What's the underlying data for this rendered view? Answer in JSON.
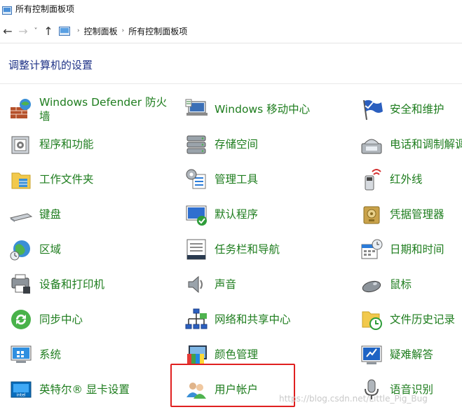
{
  "window": {
    "title": "所有控制面板项"
  },
  "nav": {
    "back_glyph": "←",
    "forward_glyph": "→",
    "recent_glyph": "˅",
    "up_glyph": "↑",
    "breadcrumb": [
      "控制面板",
      "所有控制面板项"
    ],
    "breadcrumb_sep": "›"
  },
  "heading": "调整计算机的设置",
  "colors": {
    "link_green": "#1e7d1e",
    "heading_blue": "#1e3287",
    "highlight_red": "#e02020"
  },
  "items": [
    {
      "label": "Windows Defender 防火墙",
      "icon": "firewall-icon"
    },
    {
      "label": "Windows 移动中心",
      "icon": "mobility-center-icon"
    },
    {
      "label": "安全和维护",
      "icon": "security-flag-icon"
    },
    {
      "label": "程序和功能",
      "icon": "programs-icon"
    },
    {
      "label": "存储空间",
      "icon": "storage-icon"
    },
    {
      "label": "电话和调制解调",
      "icon": "phone-modem-icon"
    },
    {
      "label": "工作文件夹",
      "icon": "work-folders-icon"
    },
    {
      "label": "管理工具",
      "icon": "admin-tools-icon"
    },
    {
      "label": "红外线",
      "icon": "infrared-icon"
    },
    {
      "label": "键盘",
      "icon": "keyboard-icon"
    },
    {
      "label": "默认程序",
      "icon": "default-programs-icon"
    },
    {
      "label": "凭据管理器",
      "icon": "credential-manager-icon"
    },
    {
      "label": "区域",
      "icon": "region-globe-icon"
    },
    {
      "label": "任务栏和导航",
      "icon": "taskbar-icon"
    },
    {
      "label": "日期和时间",
      "icon": "date-time-icon"
    },
    {
      "label": "设备和打印机",
      "icon": "devices-printers-icon"
    },
    {
      "label": "声音",
      "icon": "sound-icon"
    },
    {
      "label": "鼠标",
      "icon": "mouse-icon"
    },
    {
      "label": "同步中心",
      "icon": "sync-center-icon"
    },
    {
      "label": "网络和共享中心",
      "icon": "network-icon"
    },
    {
      "label": "文件历史记录",
      "icon": "file-history-icon"
    },
    {
      "label": "系统",
      "icon": "system-icon"
    },
    {
      "label": "颜色管理",
      "icon": "color-management-icon"
    },
    {
      "label": "疑难解答",
      "icon": "troubleshooting-icon"
    },
    {
      "label": "英特尔® 显卡设置",
      "icon": "intel-graphics-icon"
    },
    {
      "label": "用户帐户",
      "icon": "user-accounts-icon"
    },
    {
      "label": "语音识别",
      "icon": "speech-recognition-icon"
    }
  ],
  "watermark": "https://blog.csdn.net/Little_Pig_Bug"
}
